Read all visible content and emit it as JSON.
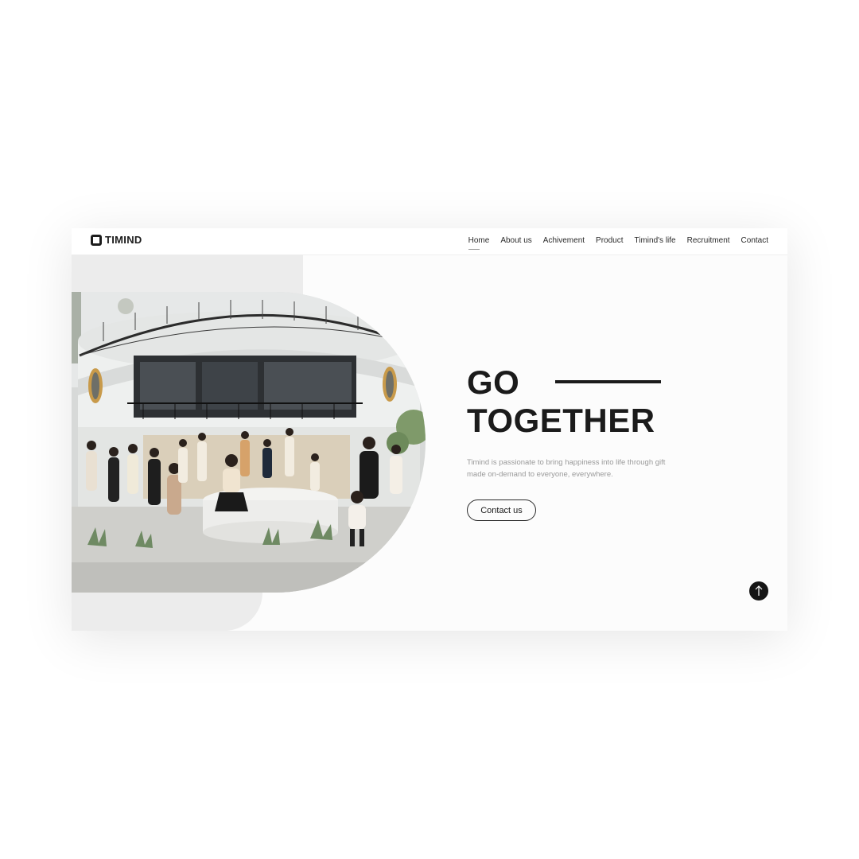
{
  "brand": {
    "name": "TIMIND"
  },
  "nav": {
    "items": [
      {
        "label": "Home",
        "active": true
      },
      {
        "label": "About us",
        "active": false
      },
      {
        "label": "Achivement",
        "active": false
      },
      {
        "label": "Product",
        "active": false
      },
      {
        "label": "Timind's life",
        "active": false
      },
      {
        "label": "Recruitment",
        "active": false
      },
      {
        "label": "Contact",
        "active": false
      }
    ]
  },
  "hero": {
    "headline_line1": "GO",
    "headline_line2": "TOGETHER",
    "description": "Timind is passionate to bring happiness into life through gift made on-demand to everyone, everywhere.",
    "cta_label": "Contact us",
    "image": "team-group-photo"
  },
  "icons": {
    "scroll_top": "arrow-up-icon"
  },
  "colors": {
    "text_dark": "#1b1b1b",
    "text_muted": "#9a9a9a",
    "panel_gray": "#ececec",
    "background": "#fcfcfc"
  }
}
